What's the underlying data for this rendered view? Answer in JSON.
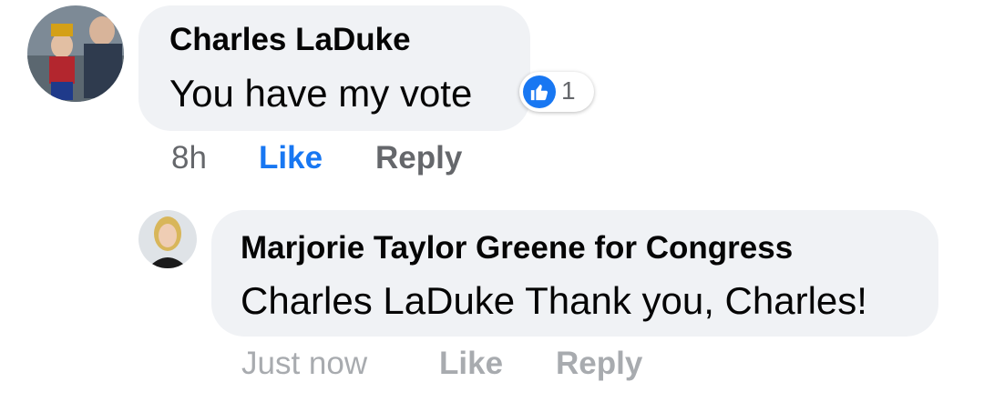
{
  "comment": {
    "author": "Charles LaDuke",
    "text": "You have my vote",
    "time": "8h",
    "like_label": "Like",
    "reply_label": "Reply",
    "reaction_icon": "thumbs-up-icon",
    "reaction_count": "1",
    "colors": {
      "like_active": "#1877f2",
      "meta_gray": "#65676b",
      "bubble_bg": "#f0f2f5"
    }
  },
  "reply": {
    "author": "Marjorie Taylor Greene for Congress",
    "mention": "Charles LaDuke",
    "text": " Thank you, Charles!",
    "time": "Just now",
    "like_label": "Like",
    "reply_label": "Reply"
  }
}
